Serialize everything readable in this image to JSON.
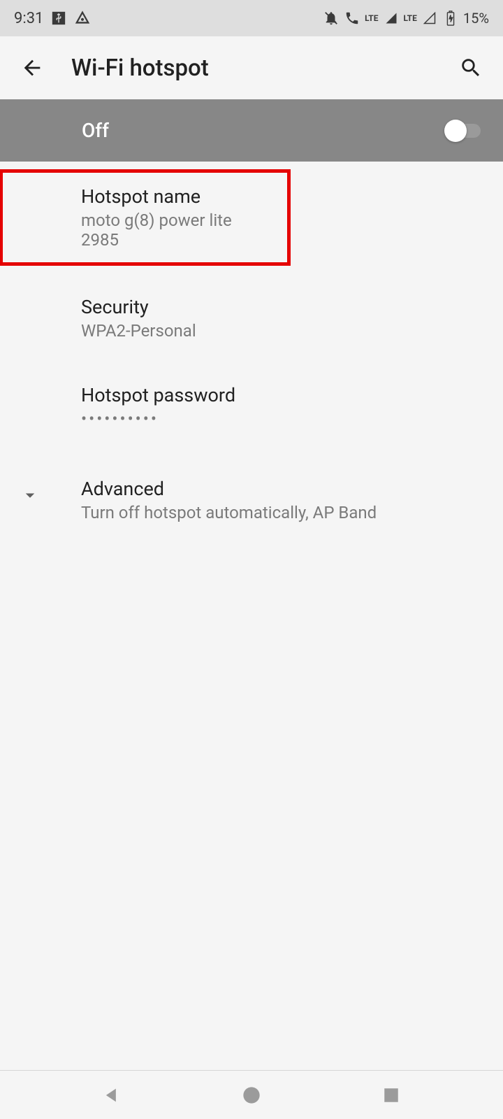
{
  "status_bar": {
    "time": "9:31",
    "battery_percent": "15%"
  },
  "app_bar": {
    "title": "Wi-Fi hotspot"
  },
  "toggle": {
    "label": "Off",
    "state": false
  },
  "settings": {
    "hotspot_name": {
      "title": "Hotspot name",
      "subtitle": "moto g(8) power lite 2985"
    },
    "security": {
      "title": "Security",
      "subtitle": "WPA2-Personal"
    },
    "password": {
      "title": "Hotspot password",
      "subtitle": "••••••••••"
    },
    "advanced": {
      "title": "Advanced",
      "subtitle": "Turn off hotspot automatically, AP Band"
    }
  }
}
